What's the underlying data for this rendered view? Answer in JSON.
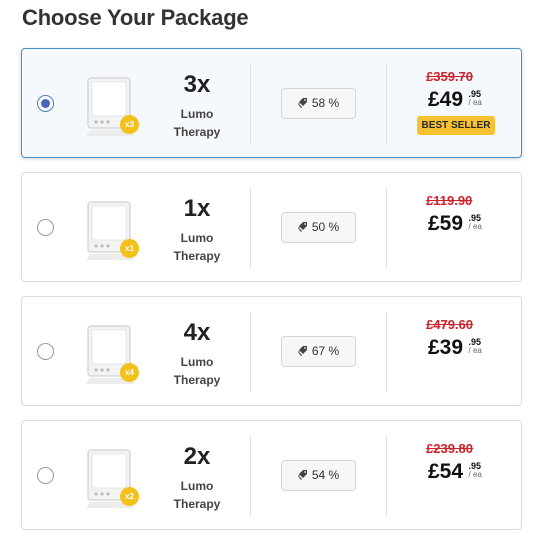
{
  "title": "Choose Your Package",
  "packages": [
    {
      "qty": "3x",
      "badge": "x3",
      "name_line1": "Lumo",
      "name_line2": "Therapy",
      "discount": "58 %",
      "old_price": "£359.70",
      "price_main": "£49",
      "price_dec": ".95",
      "price_unit": "/ ea",
      "best_seller": "BEST SELLER",
      "selected": true
    },
    {
      "qty": "1x",
      "badge": "x1",
      "name_line1": "Lumo",
      "name_line2": "Therapy",
      "discount": "50 %",
      "old_price": "£119.90",
      "price_main": "£59",
      "price_dec": ".95",
      "price_unit": "/ ea",
      "selected": false
    },
    {
      "qty": "4x",
      "badge": "x4",
      "name_line1": "Lumo",
      "name_line2": "Therapy",
      "discount": "67 %",
      "old_price": "£479.60",
      "price_main": "£39",
      "price_dec": ".95",
      "price_unit": "/ ea",
      "selected": false
    },
    {
      "qty": "2x",
      "badge": "x2",
      "name_line1": "Lumo",
      "name_line2": "Therapy",
      "discount": "54 %",
      "old_price": "£239.80",
      "price_main": "£54",
      "price_dec": ".95",
      "price_unit": "/ ea",
      "selected": false
    }
  ],
  "icons": {
    "product": "lamp-device-icon",
    "discount": "tag-icon",
    "radio": "radio-button-icon"
  },
  "colors": {
    "selected_border": "#4a90c8",
    "radio_dot": "#4669b5",
    "old_price": "#d0202a",
    "badge": "#f2c11a",
    "best_seller": "#f6c232"
  }
}
